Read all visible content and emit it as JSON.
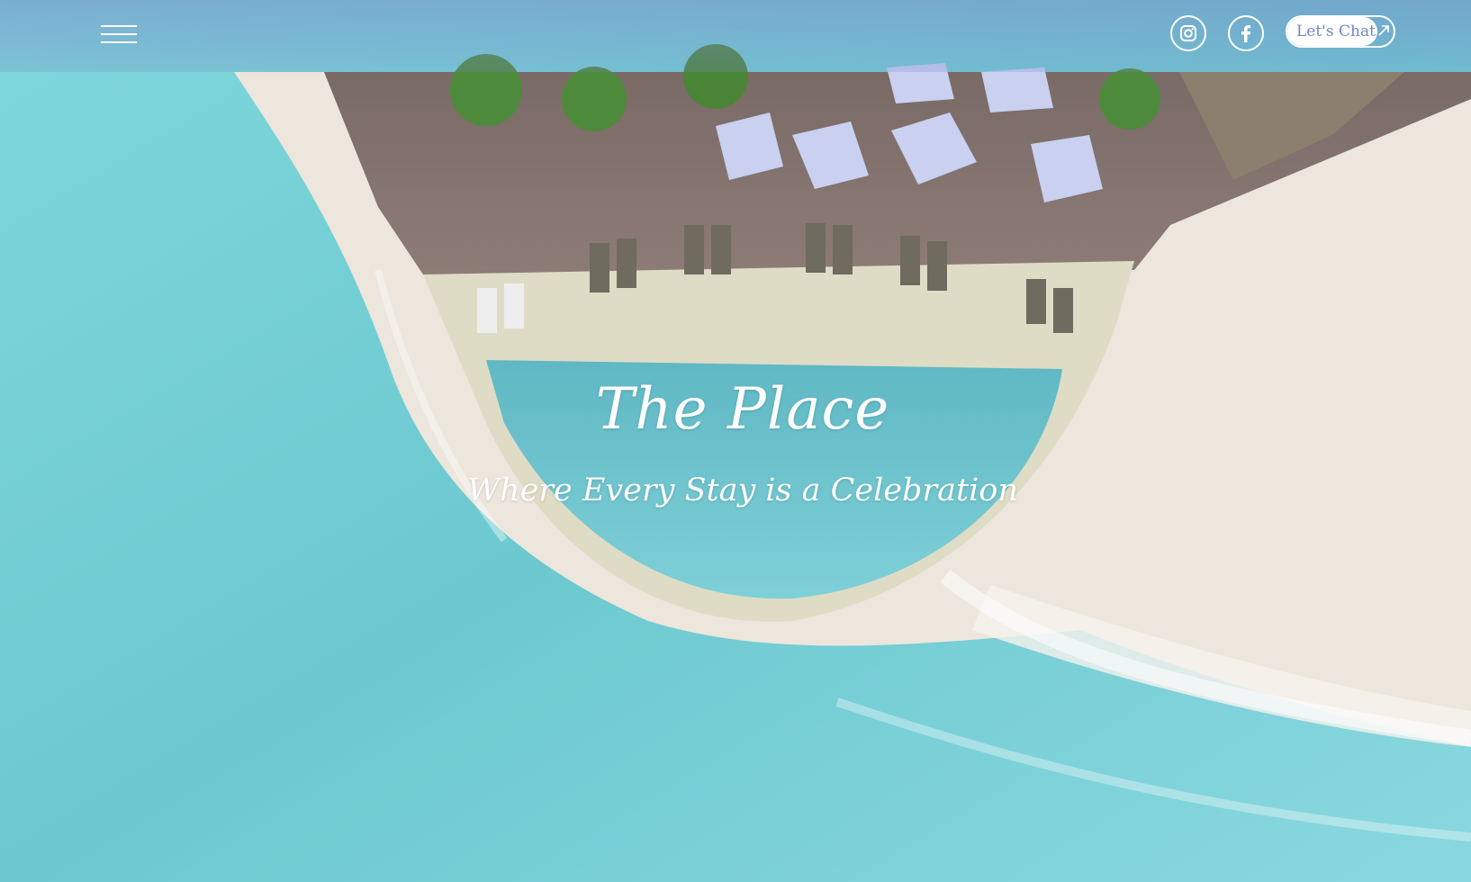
{
  "header": {
    "menu_label": "",
    "social": {
      "instagram_icon": "instagram-icon",
      "facebook_icon": "facebook-icon"
    },
    "chat_button_label": "Let's Chat",
    "chat_icon": "arrow-up-right-icon"
  },
  "hero": {
    "title": "The Place",
    "subtitle": "Where Every Stay is a Celebration"
  },
  "colors": {
    "accent": "#6f86c9",
    "text": "#ffffff",
    "water": "#6fd0d6",
    "sand": "#ece6dc"
  }
}
